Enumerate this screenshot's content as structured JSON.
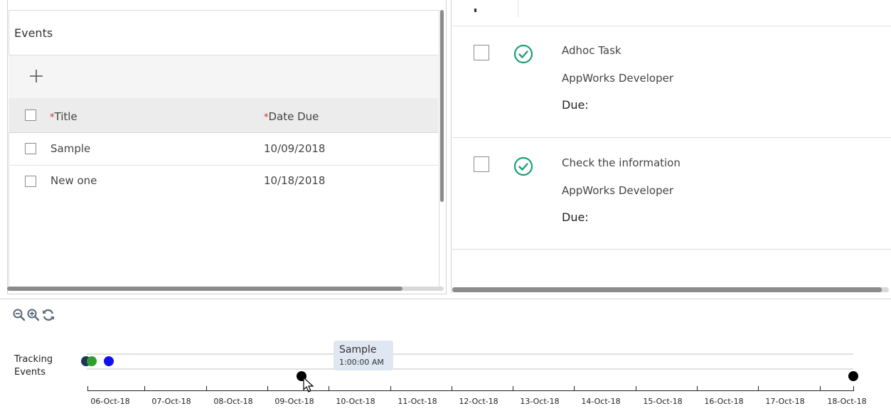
{
  "events_panel": {
    "title": "Events",
    "add_icon": "plus-icon",
    "columns": [
      {
        "label": "Title",
        "required_mark": "*"
      },
      {
        "label": "Date Due",
        "required_mark": "*"
      }
    ],
    "rows": [
      {
        "title": "Sample",
        "date_due": "10/09/2018"
      },
      {
        "title": "New one",
        "date_due": "10/18/2018"
      }
    ]
  },
  "tasks_panel": {
    "tasks": [
      {
        "title": "Adhoc Task",
        "assignee": "AppWorks Developer",
        "due_label": "Due:",
        "status_icon": "check-circle-icon"
      },
      {
        "title": "Check the information",
        "assignee": "AppWorks Developer",
        "due_label": "Due:",
        "status_icon": "check-circle-icon"
      }
    ]
  },
  "timeline": {
    "tools": [
      "zoom-out-icon",
      "zoom-in-icon",
      "refresh-icon"
    ],
    "track_label_line1": "Tracking",
    "track_label_line2": "Events",
    "tooltip": {
      "title": "Sample",
      "time": "1:00:00 AM"
    },
    "axis_labels": [
      "06-Oct-18",
      "07-Oct-18",
      "08-Oct-18",
      "09-Oct-18",
      "10-Oct-18",
      "11-Oct-18",
      "12-Oct-18",
      "13-Oct-18",
      "14-Oct-18",
      "15-Oct-18",
      "16-Oct-18",
      "17-Oct-18",
      "18-Oct-18"
    ]
  },
  "colors": {
    "accent_green": "#1e9e73",
    "dot_dark": "#1d3557",
    "dot_green": "#2e9e2e",
    "dot_blue": "#1010ee",
    "dot_black": "#000000",
    "required_red": "#d32f2f"
  }
}
